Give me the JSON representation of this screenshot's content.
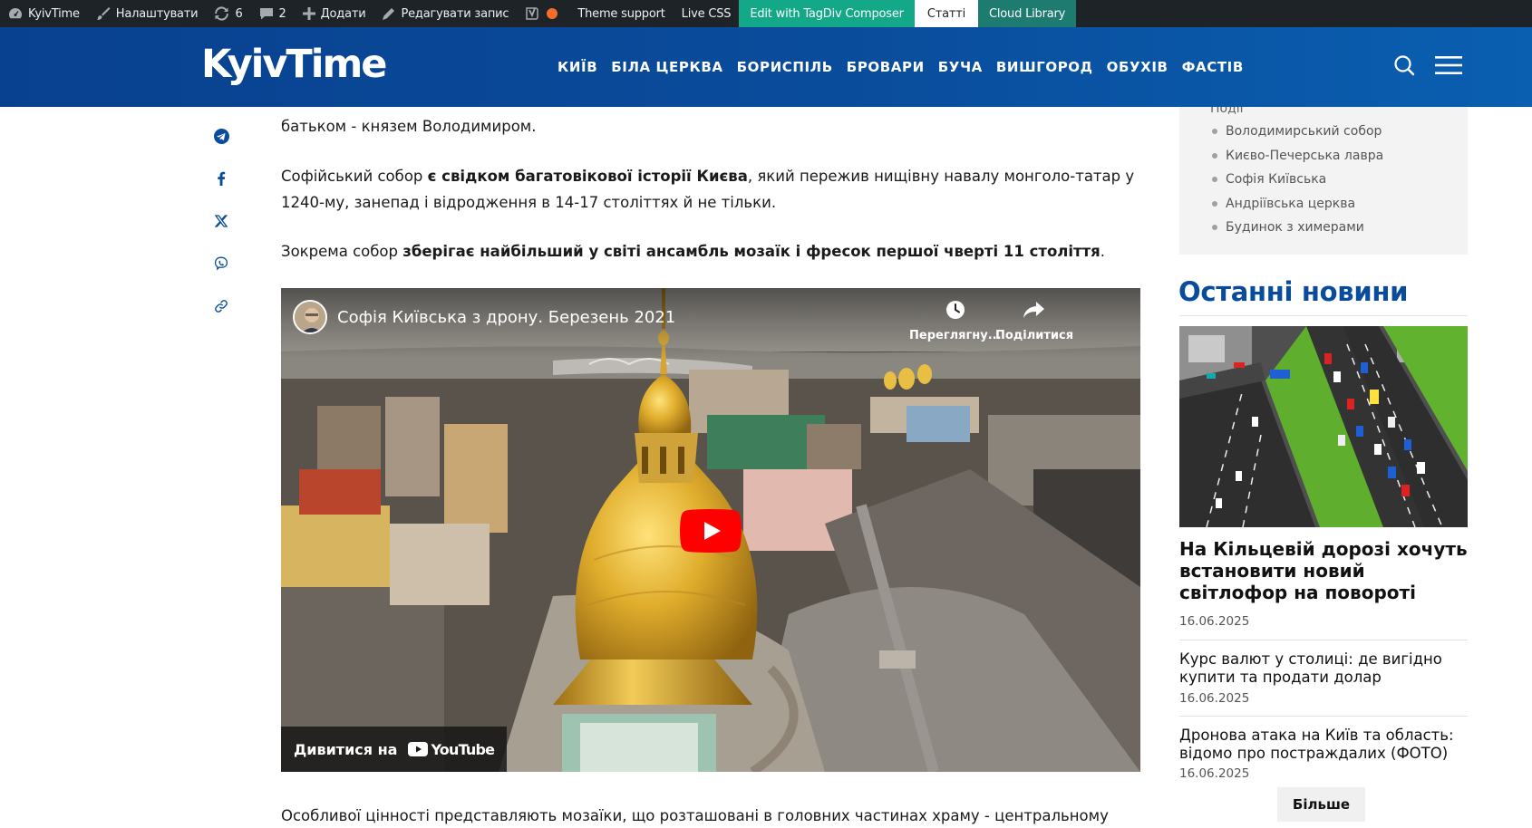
{
  "admin_bar": {
    "site_name": "KyivTime",
    "customize": "Налаштувати",
    "updates_count": "6",
    "comments_count": "2",
    "add_new": "Додати",
    "edit_post": "Редагувати запис",
    "theme_support": "Theme support",
    "live_css": "Live CSS",
    "tagdiv": "Edit with TagDiv Composer",
    "articles": "Статті",
    "cloud_library": "Cloud Library"
  },
  "header": {
    "logo": "KyivTime",
    "nav": [
      "КИЇВ",
      "БІЛА ЦЕРКВА",
      "БОРИСПІЛЬ",
      "БРОВАРИ",
      "БУЧА",
      "ВИШГОРОД",
      "ОБУХІВ",
      "ФАСТІВ"
    ]
  },
  "share": [
    "telegram-icon",
    "facebook-icon",
    "x-icon",
    "viber-icon",
    "link-icon"
  ],
  "article": {
    "p1": "батьком - князем Володимиром.",
    "p2_pre": "Софійський собор ",
    "p2_bold": "є свідком багатовікової історії Києва",
    "p2_post": ", який пережив нищівну навалу монголо-татар у 1240-му, занепад і відродження в 14-17 століттях й не тільки.",
    "p3_pre": "Зокрема собор ",
    "p3_bold": "зберігає найбільший у світі ансамбль мозаїк і фресок першої чверті 11 століття",
    "p3_post": ".",
    "p4": "Особливої цінності представляють мозаїки, що розташовані в головних частинах храму - центральному куполі та"
  },
  "video": {
    "title": "Софія Київська з дрону. Березень 2021",
    "watch_later": "Переглягну...",
    "share": "Поділитися",
    "watch_on": "Дивитися на",
    "youtube": "YouTube"
  },
  "sidebar": {
    "cut_text": "Події",
    "links": [
      "Володимирський собор",
      "Києво-Печерська лавра",
      "Софія Київська",
      "Андріївська церква",
      "Будинок з химерами"
    ],
    "latest_title": "Останні новини",
    "news": [
      {
        "title": "На Кільцевій дорозі хочуть встановити новий світлофор на повороті",
        "date": "16.06.2025"
      },
      {
        "title": "Курс валют у столиці: де вигідно купити та продати долар",
        "date": "16.06.2025"
      },
      {
        "title": "Дронова атака на Київ та область: відомо про постраждалих (ФОТО)",
        "date": "16.06.2025"
      }
    ],
    "more": "Більше"
  },
  "colors": {
    "admin_bg": "#1d2327",
    "header_blue": "#0a4c9c",
    "tagdiv_green": "#13a887",
    "cloud_teal": "#1e7b70",
    "youtube_red": "#ff0000",
    "accent_orange": "#f56e28"
  }
}
